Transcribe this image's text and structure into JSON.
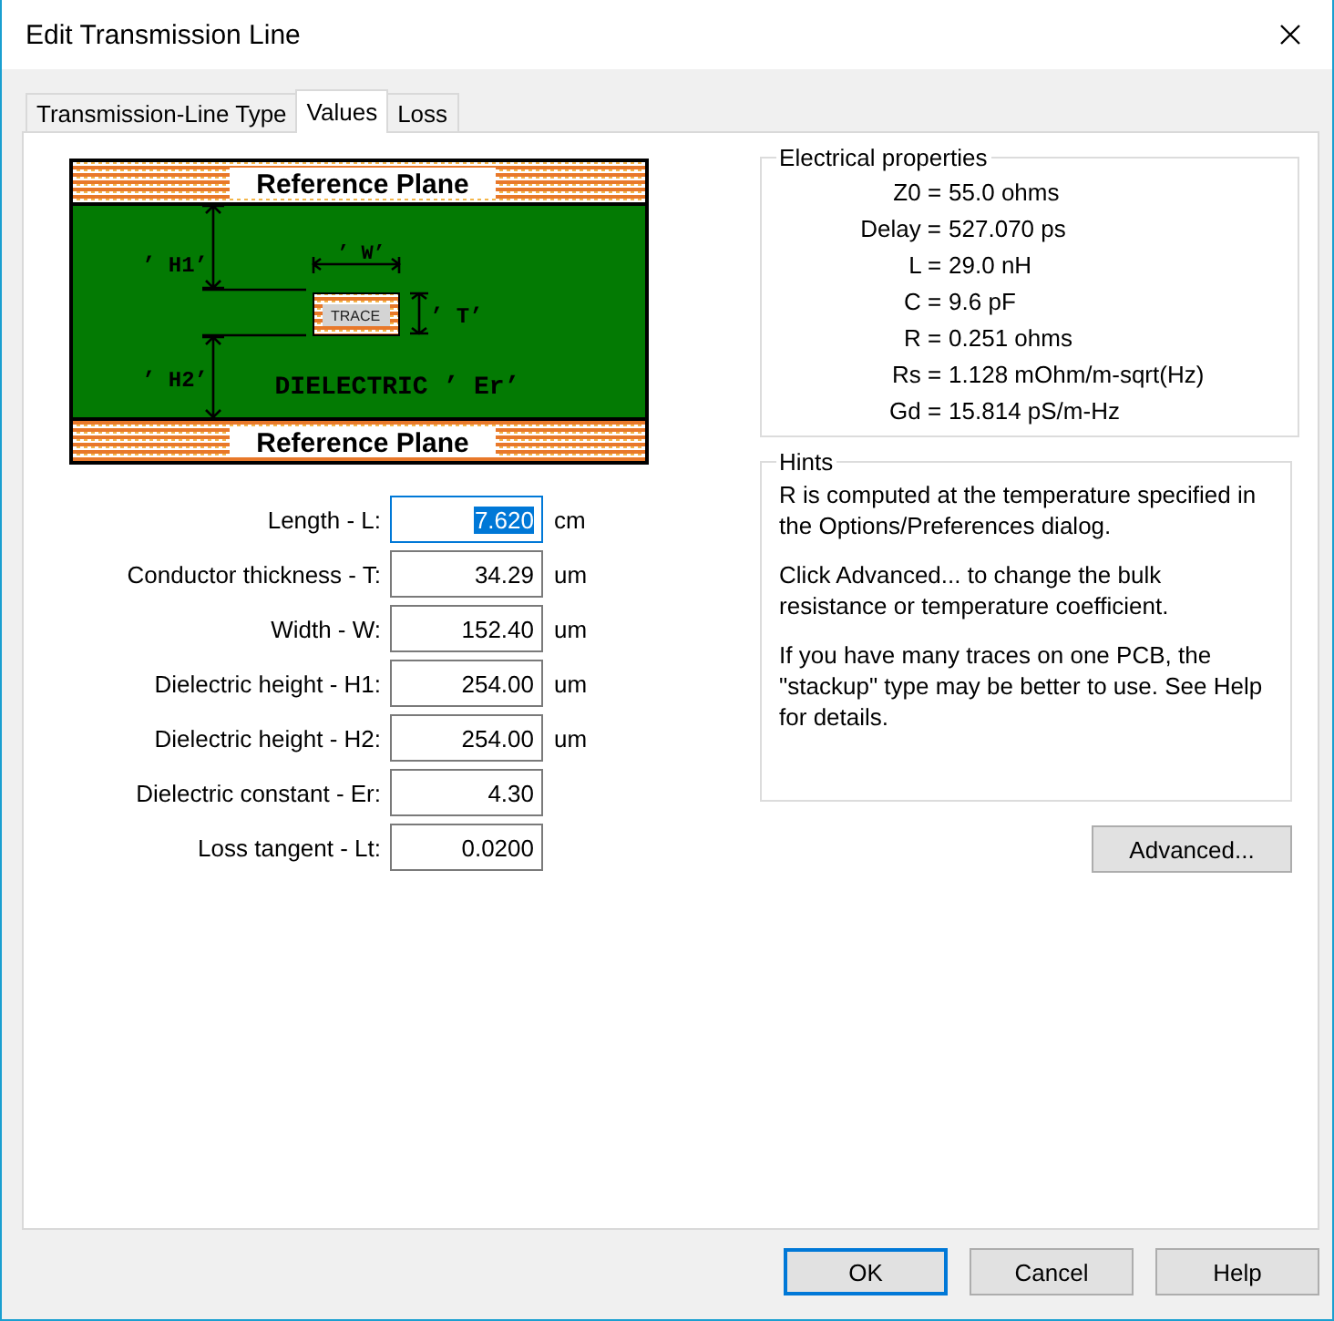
{
  "window": {
    "title": "Edit Transmission Line"
  },
  "tabs": [
    {
      "label": "Transmission-Line Type",
      "selected": false
    },
    {
      "label": "Values",
      "selected": true
    },
    {
      "label": "Loss",
      "selected": false
    }
  ],
  "diagram": {
    "top_plane": "Reference Plane",
    "bottom_plane": "Reference Plane",
    "h1": "’ H1’",
    "w": "’ W’",
    "trace": "TRACE",
    "t": "’ T’",
    "h2": "’ H2’",
    "dielectric": "DIELECTRIC ’ Er’"
  },
  "fields": [
    {
      "label": "Length - L:",
      "value": "7.620",
      "unit": "cm",
      "selected": true
    },
    {
      "label": "Conductor thickness - T:",
      "value": "34.29",
      "unit": "um",
      "selected": false
    },
    {
      "label": "Width - W:",
      "value": "152.40",
      "unit": "um",
      "selected": false
    },
    {
      "label": "Dielectric height - H1:",
      "value": "254.00",
      "unit": "um",
      "selected": false
    },
    {
      "label": "Dielectric height - H2:",
      "value": "254.00",
      "unit": "um",
      "selected": false
    },
    {
      "label": "Dielectric constant - Er:",
      "value": "4.30",
      "selected": false
    },
    {
      "label": "Loss tangent - Lt:",
      "value": "0.0200",
      "selected": false
    }
  ],
  "electrical_properties": {
    "title": "Electrical properties",
    "rows": [
      {
        "name": "Z0 =",
        "value": "55.0 ohms"
      },
      {
        "name": "Delay =",
        "value": "527.070 ps"
      },
      {
        "name": "L =",
        "value": "29.0 nH"
      },
      {
        "name": "C =",
        "value": "9.6 pF"
      },
      {
        "name": "R =",
        "value": "0.251 ohms"
      },
      {
        "name": "Rs =",
        "value": "1.128 mOhm/m-sqrt(Hz)"
      },
      {
        "name": "Gd =",
        "value": "15.814 pS/m-Hz"
      }
    ]
  },
  "hints": {
    "title": "Hints",
    "paragraphs": [
      "R is computed at the temperature specified in the Options/Preferences dialog.",
      "Click Advanced... to change the bulk resistance or temperature coefficient.",
      "If you have many traces on one PCB, the \"stackup\" type may be better to use.  See Help for details."
    ]
  },
  "advanced_button": "Advanced...",
  "buttons": [
    {
      "label": "OK",
      "default": true
    },
    {
      "label": "Cancel",
      "default": false
    },
    {
      "label": "Help",
      "default": false
    }
  ]
}
